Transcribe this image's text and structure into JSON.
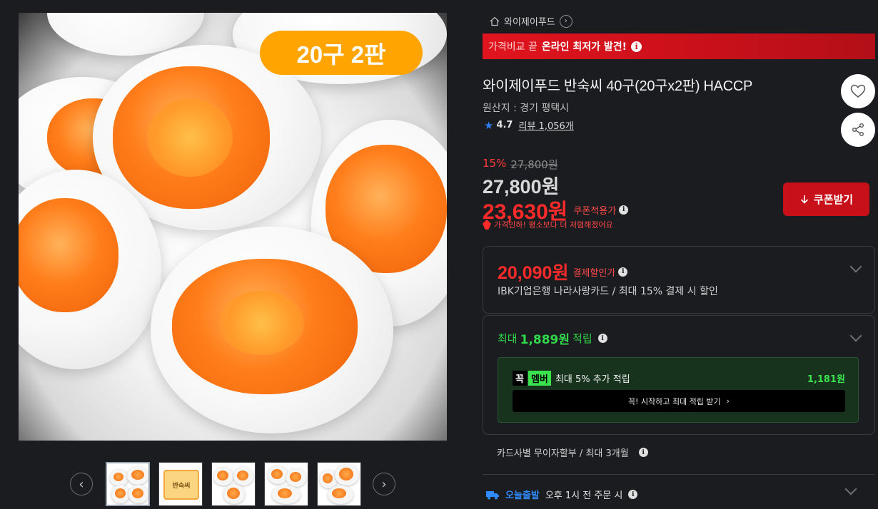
{
  "gallery": {
    "badge": "20구 2판",
    "thumb_card_text": "반숙씨",
    "prev": "‹",
    "next": "›"
  },
  "brand": {
    "name": "와이제이푸드",
    "arrow": "›"
  },
  "promo": {
    "prefix": "가격비교 끝",
    "highlight": "온라인 최저가 발견!",
    "info": "i"
  },
  "product": {
    "title": "와이제이푸드 반숙씨 40구(20구x2판) HACCP",
    "origin": "원산지 : 경기 평택시",
    "rating": "4.7",
    "review_label": "리뷰",
    "review_count": "1,056개"
  },
  "price": {
    "discount_rate": "15%",
    "original": "27,800원",
    "sale": "27,800원",
    "coupon_price": "23,630원",
    "coupon_label": "쿠폰적용가",
    "price_drop_note": "가격인하! 평소보다 더 저렴해졌어요",
    "coupon_button": "쿠폰받기"
  },
  "card_discount": {
    "price": "20,090원",
    "label": "결제할인가",
    "description": "IBK기업은행 나라사랑카드 / 최대 15% 결제 시 할인"
  },
  "reward": {
    "head_prefix": "최대",
    "head_amount": "1,889원",
    "head_suffix": "적립",
    "member_tag1": "꼭",
    "member_tag2": "멤버",
    "member_text": "최대 5% 추가 적립",
    "member_amount": "1,181원",
    "cta": "꼭! 시작하고 최대 적립 받기",
    "cta_arrow": "›"
  },
  "installment": "카드사별 무이자할부 / 최대 3개월",
  "delivery": {
    "badge": "오늘출발",
    "text": "오후 1시 전 주문 시"
  },
  "colors": {
    "accent_red": "#c8101a",
    "price_red": "#ff2a2a",
    "reward_green": "#31d84a",
    "badge_orange": "#ffa400",
    "delivery_blue": "#2f8bff"
  }
}
